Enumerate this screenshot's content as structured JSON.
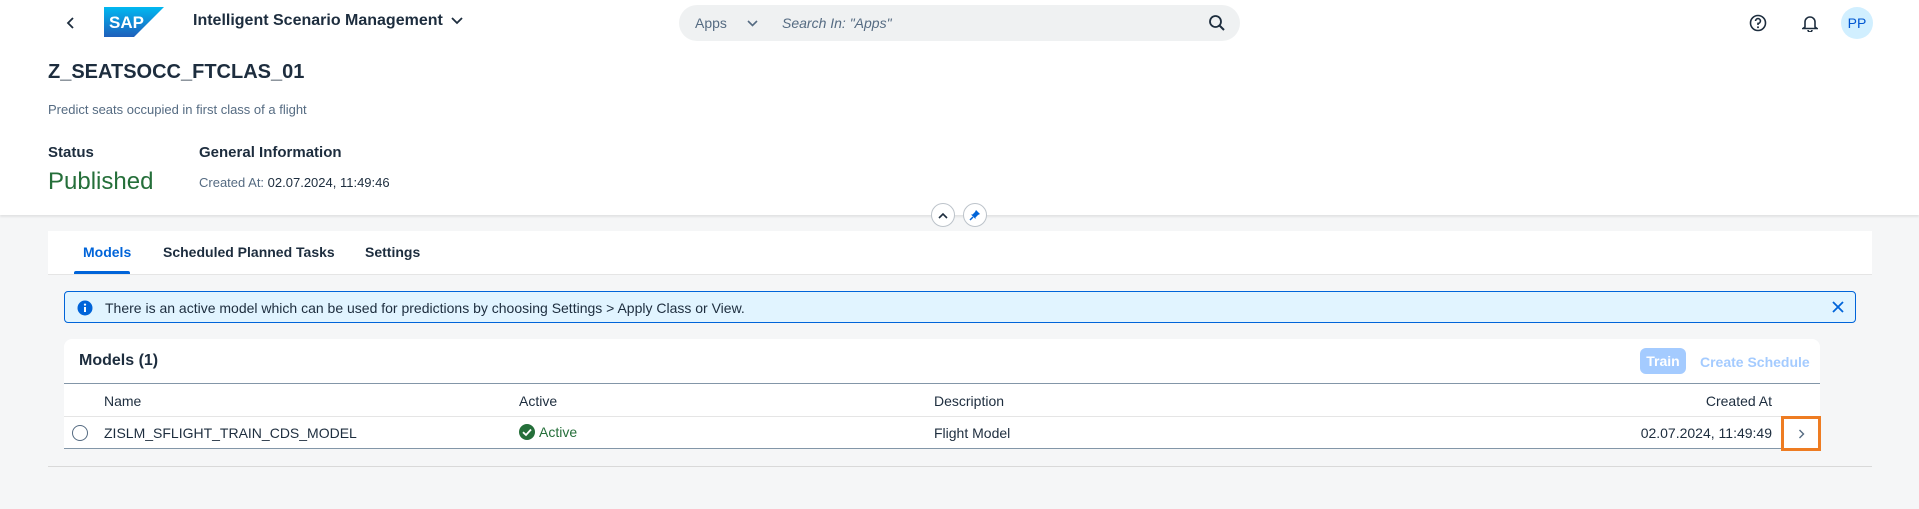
{
  "shell": {
    "logo_text": "SAP",
    "app_title": "Intelligent Scenario Management",
    "search_scope": "Apps",
    "search_placeholder": "Search In: \"Apps\"",
    "avatar_initials": "PP"
  },
  "header": {
    "title": "Z_SEATSOCC_FTCLAS_01",
    "subtitle": "Predict seats occupied in first class of a flight",
    "status_label": "Status",
    "status_value": "Published",
    "general_label": "General Information",
    "created_at_label": "Created At:",
    "created_at_value": "02.07.2024, 11:49:46"
  },
  "tabs": [
    {
      "label": "Models",
      "selected": true
    },
    {
      "label": "Scheduled Planned Tasks",
      "selected": false
    },
    {
      "label": "Settings",
      "selected": false
    }
  ],
  "info_strip": {
    "text": "There is an active model which can be used for predictions by choosing Settings > Apply Class or View."
  },
  "models_table": {
    "title": "Models (1)",
    "train_label": "Train",
    "create_schedule_label": "Create Schedule",
    "columns": [
      "Name",
      "Active",
      "Description",
      "Created At"
    ],
    "rows": [
      {
        "name": "ZISLM_SFLIGHT_TRAIN_CDS_MODEL",
        "active": "Active",
        "description": "Flight Model",
        "created_at": "02.07.2024, 11:49:49"
      }
    ]
  },
  "colors": {
    "brand": "#0064d9",
    "positive": "#256f3a",
    "highlight": "#ee7c22",
    "disabled_button": "#a4cbff"
  },
  "icons": [
    "back-arrow-icon",
    "chevron-down-icon",
    "search-icon",
    "help-icon",
    "bell-icon",
    "collapse-header-icon",
    "pin-icon",
    "info-icon",
    "close-icon",
    "check-circle-icon",
    "chevron-right-icon"
  ]
}
